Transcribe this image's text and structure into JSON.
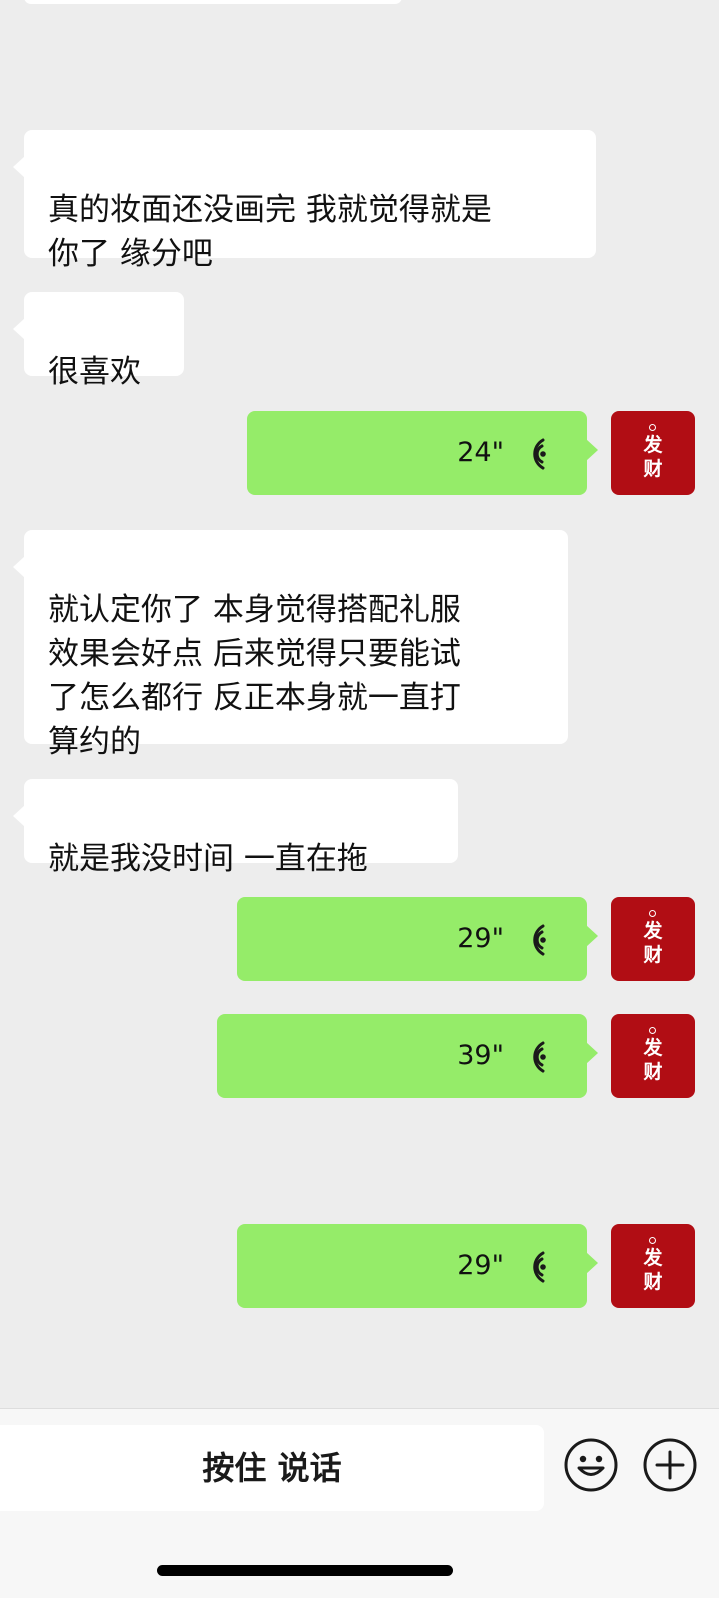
{
  "chat": {
    "messages": [
      {
        "side": "in",
        "text": "真的妆面还没画完 我就觉得就是\n你了  缘分吧"
      },
      {
        "side": "in",
        "text": "很喜欢"
      },
      {
        "side": "out",
        "type": "voice",
        "duration": "24\""
      },
      {
        "side": "in",
        "text": "就认定你了  本身觉得搭配礼服\n效果会好点  后来觉得只要能试\n了怎么都行  反正本身就一直打\n算约的"
      },
      {
        "side": "in",
        "text": "就是我没时间  一直在拖"
      },
      {
        "side": "out",
        "type": "voice",
        "duration": "29\""
      },
      {
        "side": "out",
        "type": "voice",
        "duration": "39\""
      },
      {
        "side": "out",
        "type": "voice",
        "duration": "29\""
      }
    ],
    "avatar_text": "发\n财",
    "voice_icon": "voice-wave-icon"
  },
  "toolbar": {
    "hold_to_talk": "按住 说话",
    "emoji_icon": "emoji-icon",
    "plus_icon": "plus-icon"
  },
  "colors": {
    "background": "#ededed",
    "incoming_bubble": "#ffffff",
    "outgoing_bubble": "#95ec69",
    "avatar_bg": "#b10d14"
  }
}
